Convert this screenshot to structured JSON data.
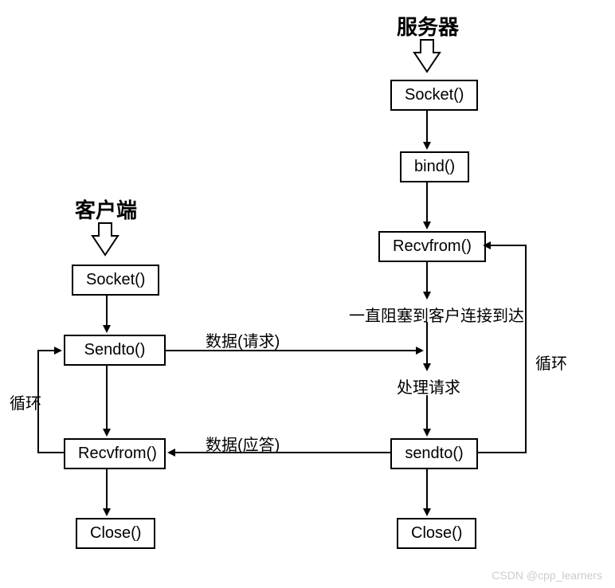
{
  "titles": {
    "server": "服务器",
    "client": "客户端"
  },
  "server": {
    "socket": "Socket()",
    "bind": "bind()",
    "recvfrom": "Recvfrom()",
    "blockText": "一直阻塞到客户连接到达",
    "process": "处理请求",
    "sendto": "sendto()",
    "close": "Close()",
    "loop": "循环"
  },
  "client": {
    "socket": "Socket()",
    "sendto": "Sendto()",
    "recvfrom": "Recvfrom()",
    "close": "Close()",
    "loop": "循环"
  },
  "flow": {
    "request": "数据(请求)",
    "response": "数据(应答)"
  },
  "watermark": "CSDN @cpp_learners"
}
